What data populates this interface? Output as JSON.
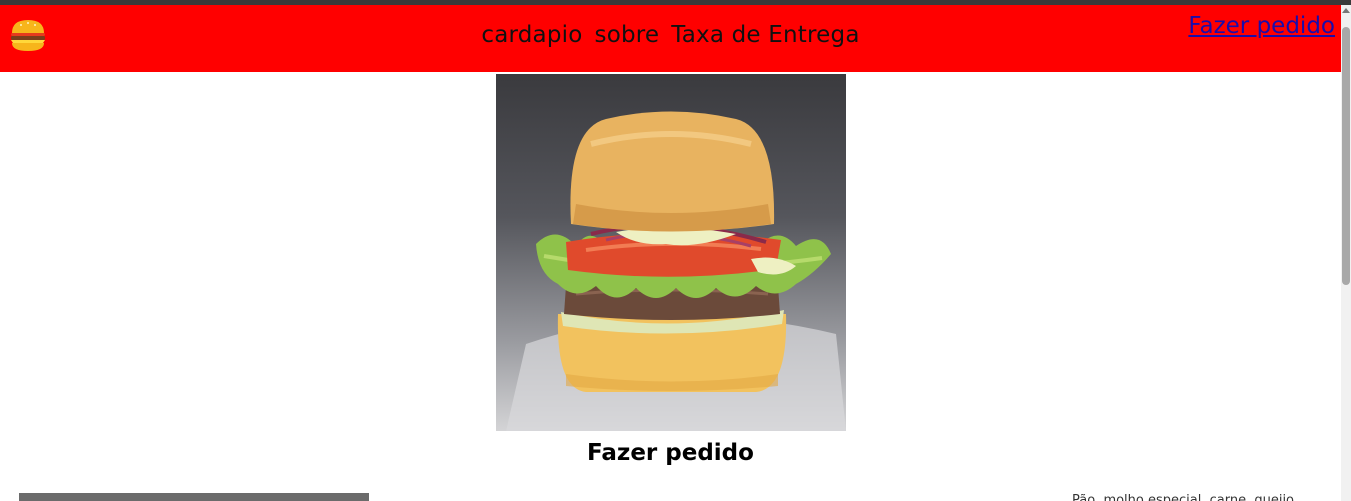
{
  "header": {
    "logo_icon": "burger-icon",
    "nav": [
      {
        "label": "cardapio"
      },
      {
        "label": "sobre"
      },
      {
        "label": "Taxa de Entrega"
      }
    ],
    "order_link": "Fazer pedido",
    "colors": {
      "background": "#ff0000",
      "link": "#1a0dab"
    }
  },
  "hero": {
    "image_icon": "burger-photo",
    "title": "Fazer pedido"
  },
  "below": {
    "peek_text": "Pão, molho especial, carne, queijo"
  }
}
